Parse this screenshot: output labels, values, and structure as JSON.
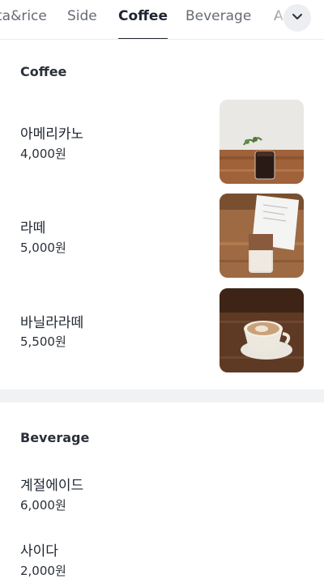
{
  "tabs": [
    {
      "label": "ta&rice",
      "active": false
    },
    {
      "label": "Side",
      "active": false
    },
    {
      "label": "Coffee",
      "active": true
    },
    {
      "label": "Beverage",
      "active": false
    },
    {
      "label": "A",
      "active": false
    }
  ],
  "more_icon": "chevron-down-icon",
  "sections": [
    {
      "title": "Coffee",
      "items": [
        {
          "name": "아메리카노",
          "price": "4,000원",
          "image": "iced-americano-photo"
        },
        {
          "name": "라떼",
          "price": "5,000원",
          "image": "iced-latte-photo"
        },
        {
          "name": "바닐라라떼",
          "price": "5,500원",
          "image": "hot-latte-cup-photo"
        }
      ]
    },
    {
      "title": "Beverage",
      "items": [
        {
          "name": "계절에이드",
          "price": "6,000원"
        },
        {
          "name": "사이다",
          "price": "2,000원"
        }
      ]
    }
  ],
  "colors": {
    "active_tab": "#1f2530",
    "inactive_tab": "#666b73",
    "divider": "#f1f2f4"
  }
}
